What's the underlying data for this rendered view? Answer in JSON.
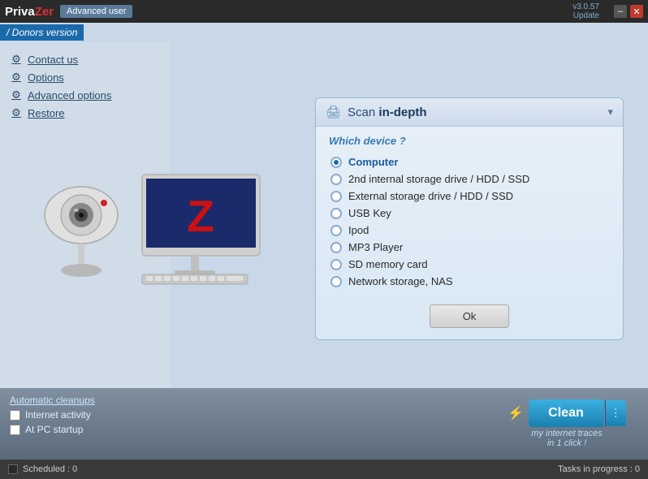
{
  "titleBar": {
    "appName": "Priva",
    "appNameSuffix": "Zer",
    "userBadge": "Advanced user",
    "version": "v3.0.57",
    "updateLabel": "Update",
    "minimizeLabel": "–",
    "closeLabel": "✕"
  },
  "donorsBar": {
    "label": "/ Donors version"
  },
  "sidebar": {
    "items": [
      {
        "id": "contact-us",
        "label": "Contact us",
        "icon": "⚙"
      },
      {
        "id": "options",
        "label": "Options",
        "icon": "⚙"
      },
      {
        "id": "advanced-options",
        "label": "Advanced options",
        "icon": "⚙"
      },
      {
        "id": "restore",
        "label": "Restore",
        "icon": "⚙"
      }
    ]
  },
  "scanPanel": {
    "title": "Scan in-depth",
    "titleIn": "Scan ",
    "titleDepth": "in-depth",
    "whichDevice": "Which device ?",
    "devices": [
      {
        "id": "computer",
        "label": "Computer",
        "selected": true
      },
      {
        "id": "2nd-hdd",
        "label": "2nd internal storage drive / HDD / SSD",
        "selected": false
      },
      {
        "id": "external",
        "label": "External storage drive  / HDD / SSD",
        "selected": false
      },
      {
        "id": "usb",
        "label": "USB Key",
        "selected": false
      },
      {
        "id": "ipod",
        "label": "Ipod",
        "selected": false
      },
      {
        "id": "mp3",
        "label": "MP3 Player",
        "selected": false
      },
      {
        "id": "sd",
        "label": "SD memory card",
        "selected": false
      },
      {
        "id": "nas",
        "label": "Network storage, NAS",
        "selected": false
      }
    ],
    "okLabel": "Ok"
  },
  "bottomPanel": {
    "autoCleanupsLabel": "Automatic cleanups",
    "checkboxes": [
      {
        "id": "internet",
        "label": "Internet activity",
        "checked": false
      },
      {
        "id": "startup",
        "label": "At PC startup",
        "checked": false
      }
    ],
    "cleanButton": "Clean",
    "cleanSubLine1": "my internet traces",
    "cleanSubLine2": "in 1 click !"
  },
  "statusBar": {
    "scheduledLabel": "Scheduled : 0",
    "tasksLabel": "Tasks in progress : 0"
  }
}
